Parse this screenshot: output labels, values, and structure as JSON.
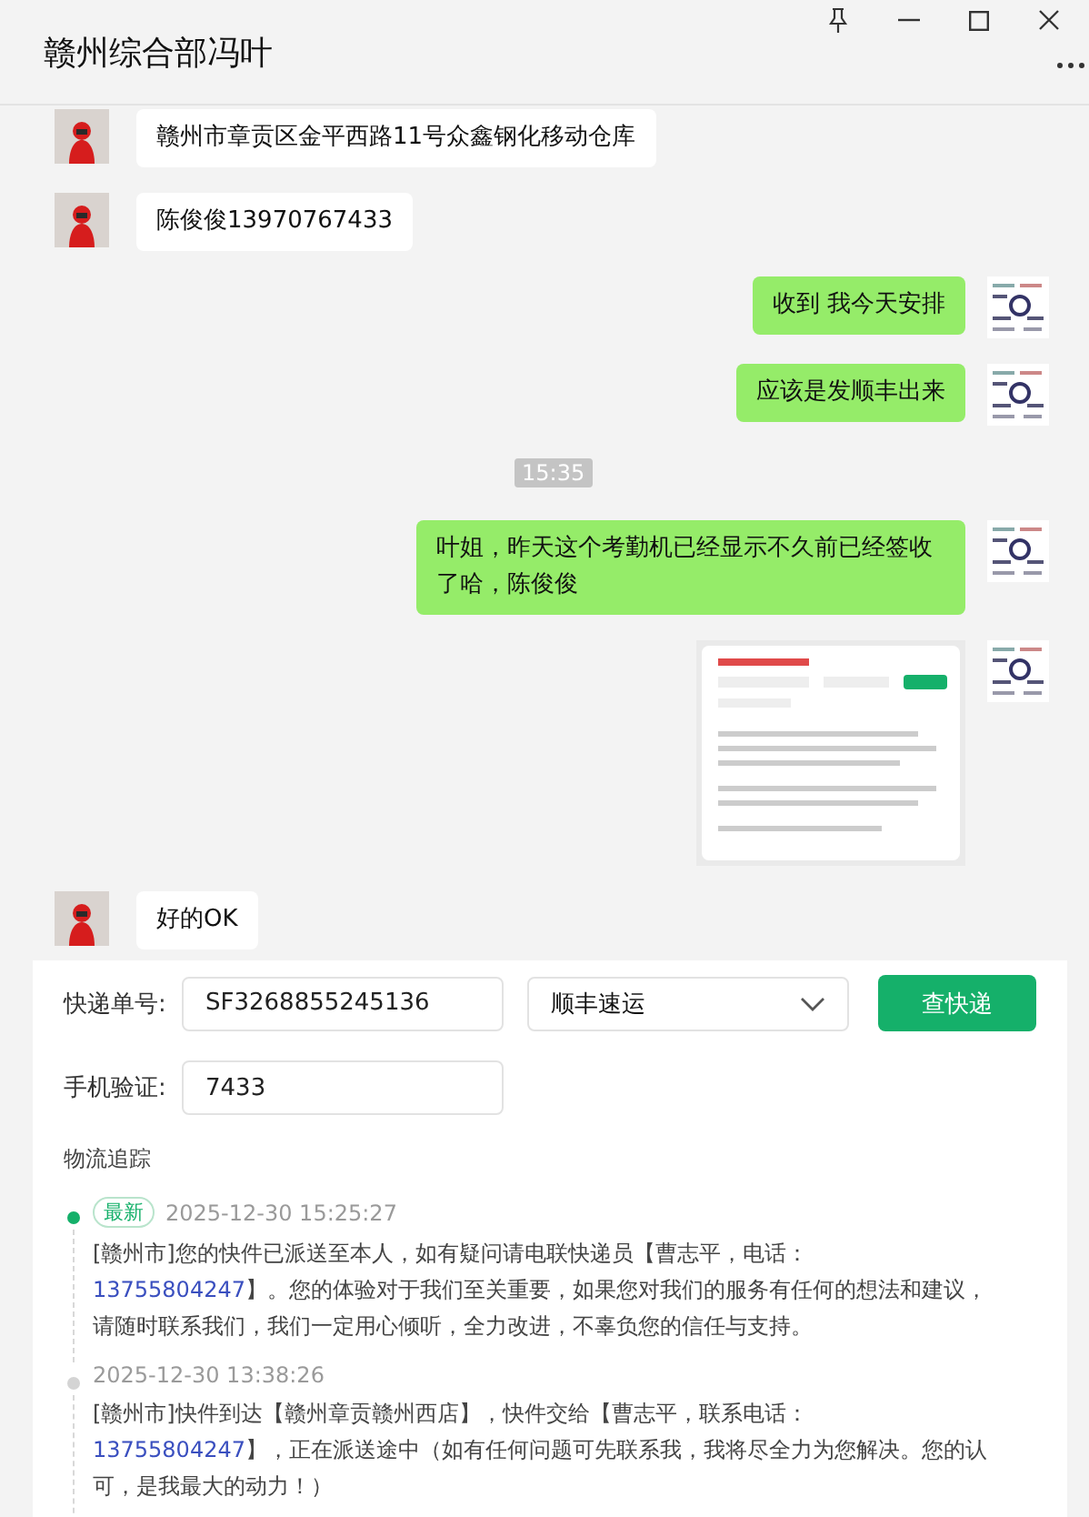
{
  "window": {
    "title": "赣州综合部冯叶"
  },
  "messages": [
    {
      "kind": "text",
      "outgoing": false,
      "text": "赣州市章贡区金平西路11号众鑫钢化移动仓库"
    },
    {
      "kind": "text",
      "outgoing": false,
      "text": "陈俊俊13970767433"
    },
    {
      "kind": "text",
      "outgoing": true,
      "text": "收到  我今天安排"
    },
    {
      "kind": "text",
      "outgoing": true,
      "text": "应该是发顺丰出来"
    },
    {
      "kind": "time",
      "text": "15:35"
    },
    {
      "kind": "text",
      "outgoing": true,
      "text": "叶姐，昨天这个考勤机已经显示不久前已经签收了哈，陈俊俊"
    },
    {
      "kind": "picture",
      "outgoing": true
    },
    {
      "kind": "text",
      "outgoing": false,
      "text": "好的OK"
    }
  ],
  "tracking_card": {
    "number_label": "快递单号:",
    "number_value": "SF3268855245136",
    "carrier": "顺丰速运",
    "query_button": "查快递",
    "phone_label": "手机验证:",
    "phone_value": "7433",
    "section_title": "物流追踪",
    "events": [
      {
        "latest": true,
        "badge": "最新",
        "time": "2025-12-30 15:25:27",
        "parts": [
          {
            "text": "[赣州市]您的快件已派送至本人，如有疑问请电联快递员【曹志平，电话：",
            "link": false
          },
          {
            "text": "13755804247",
            "link": true
          },
          {
            "text": "】。您的体验对于我们至关重要，如果您对我们的服务有任何的想法和建议，请随时联系我们，我们一定用心倾听，全力改进，不辜负您的信任与支持。",
            "link": false
          }
        ]
      },
      {
        "latest": false,
        "time": "2025-12-30 13:38:26",
        "parts": [
          {
            "text": "[赣州市]快件到达【赣州章贡赣州西店】，快件交给【曹志平，联系电话：",
            "link": false
          },
          {
            "text": "13755804247",
            "link": true
          },
          {
            "text": "】，正在派送途中（如有任何问题可先联系我，我将尽全力为您解决。您的认可，是我最大的动力！）",
            "link": false
          }
        ]
      }
    ]
  }
}
